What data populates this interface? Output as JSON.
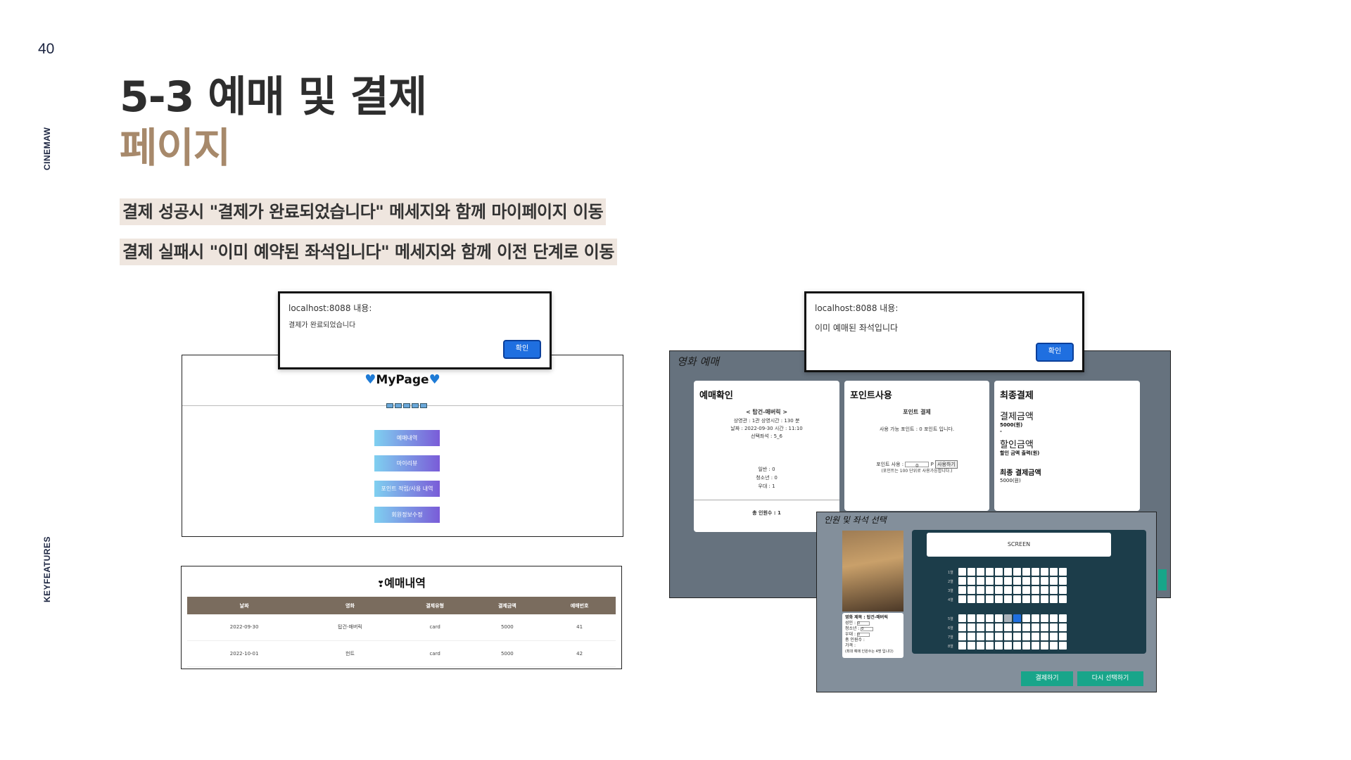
{
  "slide": {
    "page_number": "40",
    "brand": "CINEMAW",
    "section_label": "KEYFEATURES",
    "title_line1": "5-3 예매 및 결제",
    "title_line2": "페이지",
    "desc1": "결제 성공시 \"결제가 완료되었습니다\" 메세지와 함께 마이페이지 이동",
    "desc2": "결제 실패시 \"이미 예약된 좌석입니다\" 메세지와 함께 이전 단계로 이동"
  },
  "alert_success": {
    "host": "localhost:8088 내용:",
    "message": "결제가 완료되었습니다",
    "ok": "확인"
  },
  "alert_fail": {
    "host": "localhost:8088 내용:",
    "message": "이미 예매된 좌석입니다",
    "ok": "확인"
  },
  "mypage": {
    "title": "MyPage",
    "menu": [
      "예매내역",
      "마이리뷰",
      "포인트 적립/사용 내역",
      "회원정보수정"
    ]
  },
  "reservations": {
    "title": "예매내역",
    "columns": [
      "날짜",
      "영화",
      "결제유형",
      "결제금액",
      "예매번호"
    ],
    "rows": [
      [
        "2022-09-30",
        "탑건-매버릭",
        "card",
        "5000",
        "41"
      ],
      [
        "2022-10-01",
        "헌트",
        "card",
        "5000",
        "42"
      ]
    ]
  },
  "booking": {
    "window_title": "영화 예매",
    "confirm": {
      "heading": "예매확인",
      "movie": "< 탑건-매버릭 >",
      "detail1": "상영관 : 1관  상영시간 : 130 분",
      "detail2": "날짜 : 2022-09-30  시간 : 11:10",
      "detail3": "선택좌석 : 5_6",
      "adult": "일반 : 0",
      "teen": "청소년 : 0",
      "senior": "우대 : 1",
      "total": "총 인원수 : 1"
    },
    "points": {
      "heading": "포인트사용",
      "subheading": "포인트 결제",
      "available": "사용 가능 포인트 : 0 포인트 입니다.",
      "use_label": "포인트 사용 :",
      "input_value": "0",
      "unit": "P",
      "use_btn": "사용하기",
      "note": "(포인트는 100 단위로 사용가능합니다.)"
    },
    "final": {
      "heading": "최종결제",
      "amount_label": "결제금액",
      "amount_value": "5000(원)",
      "dash": "-",
      "discount_label": "할인금액",
      "discount_value": "할인 금액 출력(원)",
      "final_label": "최종 결제금액",
      "final_value": "5000(원)"
    }
  },
  "seat_select": {
    "title": "인원 및 좌석 선택",
    "screen": "SCREEN",
    "info": [
      "영화 제목 : 탑건-매버릭",
      "성인 :",
      "청소년 :",
      "우대 :",
      "총 인원수 :",
      "가격 :",
      "(최대 예매 인원수는 4명 입니다)"
    ],
    "info_adult_value": "0",
    "info_teen_value": "0",
    "info_senior_value": "0",
    "row_labels": [
      "1열",
      "2열",
      "3열",
      "4열",
      "5열",
      "6열",
      "7열",
      "8열"
    ],
    "pay_btn": "결제하기",
    "reselect_btn": "다시 선택하기"
  }
}
